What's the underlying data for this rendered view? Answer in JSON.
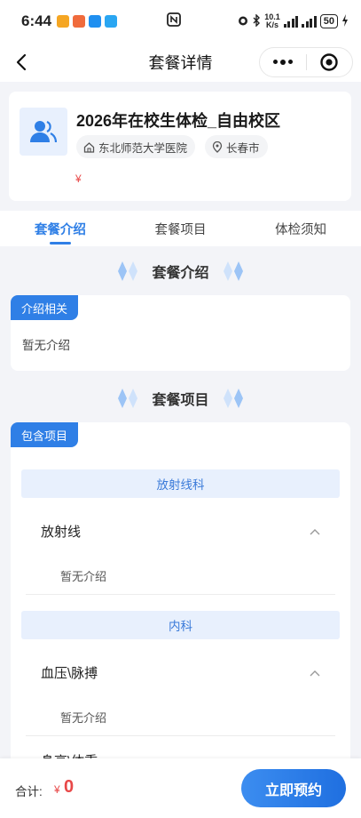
{
  "status_bar": {
    "time": "6:44",
    "net_speed_value": "10.1",
    "net_speed_unit": "K/s",
    "battery": "50"
  },
  "nav": {
    "title": "套餐详情"
  },
  "package": {
    "title": "2026年在校生体检_自由校区",
    "hospital": "东北师范大学医院",
    "city": "长春市",
    "price_symbol": "¥"
  },
  "tabs": [
    {
      "label": "套餐介绍",
      "active": true
    },
    {
      "label": "套餐项目",
      "active": false
    },
    {
      "label": "体检须知",
      "active": false
    }
  ],
  "intro_section": {
    "heading": "套餐介绍",
    "tag": "介绍相关",
    "text": "暂无介绍"
  },
  "items_section": {
    "heading": "套餐项目",
    "tag": "包含项目",
    "categories": [
      {
        "name": "放射线科",
        "items": [
          {
            "name": "放射线",
            "desc": "暂无介绍"
          }
        ]
      },
      {
        "name": "内科",
        "items": [
          {
            "name": "血压\\脉搏",
            "desc": "暂无介绍"
          },
          {
            "name": "身高\\体重"
          }
        ]
      }
    ]
  },
  "footer": {
    "total_label": "合计:",
    "currency": "¥",
    "amount": "0",
    "book_button": "立即预约"
  },
  "colors": {
    "accent": "#2f7fe6",
    "price": "#e84848",
    "category_bg": "#e8f0fd"
  }
}
